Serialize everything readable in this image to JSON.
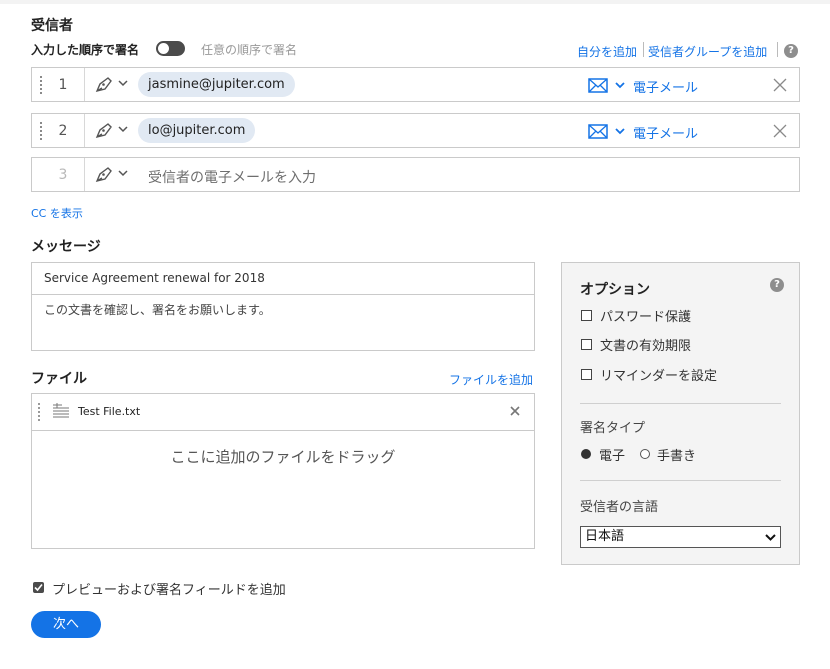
{
  "recipients_section": {
    "title": "受信者",
    "order_label_active": "入力した順序で署名",
    "order_label_inactive": "任意の順序で署名",
    "add_self_link": "自分を追加",
    "add_group_link": "受信者グループを追加",
    "help_glyph": "?",
    "rows": [
      {
        "number": "1",
        "email": "jasmine@jupiter.com",
        "delivery": "電子メール"
      },
      {
        "number": "2",
        "email": "lo@jupiter.com",
        "delivery": "電子メール"
      },
      {
        "number": "3",
        "placeholder": "受信者の電子メールを入力"
      }
    ],
    "show_cc_link": "CC を表示"
  },
  "message_section": {
    "title": "メッセージ",
    "subject": "Service Agreement renewal for 2018",
    "body": "この文書を確認し、署名をお願いします。"
  },
  "files_section": {
    "title": "ファイル",
    "add_file_link": "ファイルを追加",
    "file_name": "Test File.txt",
    "drop_hint": "ここに追加のファイルをドラッグ"
  },
  "options_panel": {
    "title": "オプション",
    "help_glyph": "?",
    "checkboxes": [
      "パスワード保護",
      "文書の有効期限",
      "リマインダーを設定"
    ],
    "signature_type_label": "署名タイプ",
    "signature_type_options": [
      "電子",
      "手書き"
    ],
    "signature_type_selected": "電子",
    "language_label": "受信者の言語",
    "language_value": "日本語"
  },
  "footer": {
    "preview_checkbox_label": "プレビューおよび署名フィールドを追加",
    "preview_checked": true,
    "next_button": "次へ"
  },
  "colors": {
    "accent": "#1473e6",
    "chip": "#e1e9f3",
    "panel": "#f4f4f4"
  },
  "icons": [
    "pen-icon",
    "chevron-down-icon",
    "mail-icon",
    "close-icon",
    "text-file-icon",
    "help-icon",
    "drag-handle-icon"
  ]
}
